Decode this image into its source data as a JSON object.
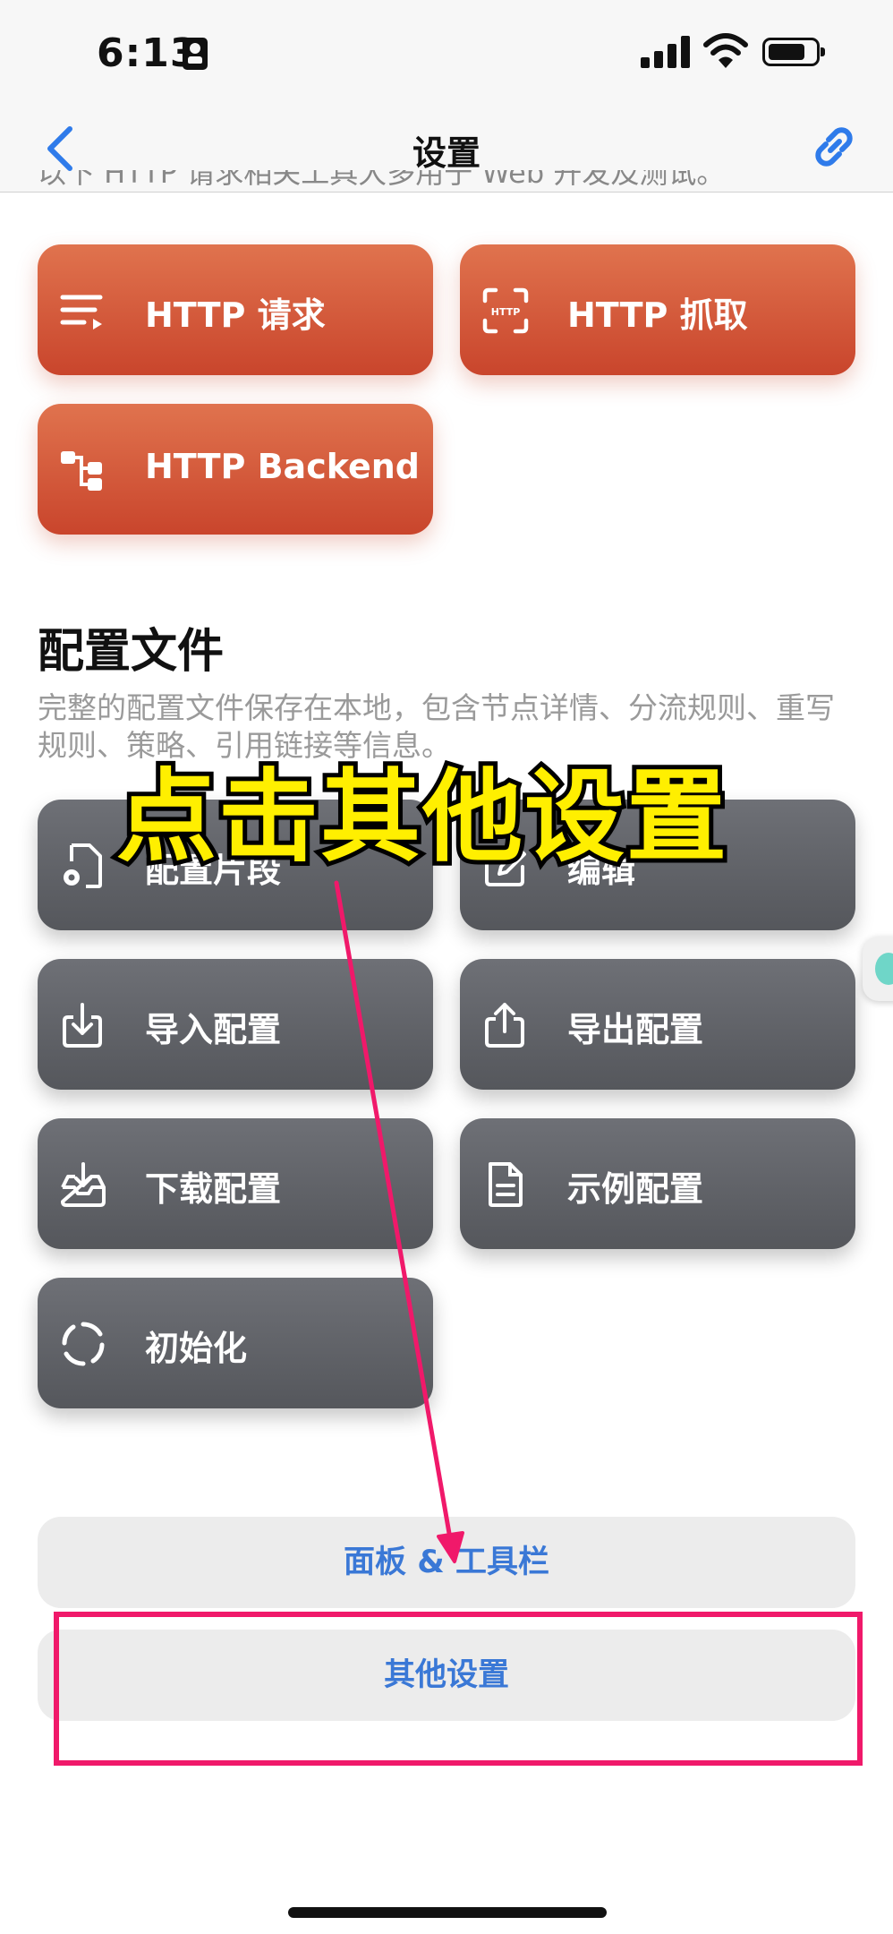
{
  "status": {
    "time": "6:13"
  },
  "nav": {
    "title": "设置"
  },
  "top_desc": "以下 HTTP 请求相关工具大多用于 Web 开发及测试。",
  "http_buttons": [
    {
      "label": "HTTP 请求",
      "icon": "list-icon"
    },
    {
      "label": "HTTP 抓取",
      "icon": "http-capture-icon"
    },
    {
      "label": "HTTP Backend",
      "icon": "backend-tree-icon"
    }
  ],
  "config": {
    "title": "配置文件",
    "desc": "完整的配置文件保存在本地，包含节点详情、分流规则、重写规则、策略、引用链接等信息。",
    "buttons": [
      {
        "label": "配置片段",
        "icon": "file-gear-icon"
      },
      {
        "label": "编辑",
        "icon": "edit-icon"
      },
      {
        "label": "导入配置",
        "icon": "import-icon"
      },
      {
        "label": "导出配置",
        "icon": "export-icon"
      },
      {
        "label": "下载配置",
        "icon": "download-tray-icon"
      },
      {
        "label": "示例配置",
        "icon": "document-icon"
      },
      {
        "label": "初始化",
        "icon": "reset-icon"
      }
    ]
  },
  "bottom_buttons": {
    "panel": "面板 & 工具栏",
    "other": "其他设置"
  },
  "annotation": {
    "caption": "点击其他设置",
    "color": "#f0196a",
    "caption_color": "#ffef00"
  },
  "colors": {
    "accent": "#3a78d6",
    "orange": "#d85a3a",
    "gray": "#5f6166"
  }
}
